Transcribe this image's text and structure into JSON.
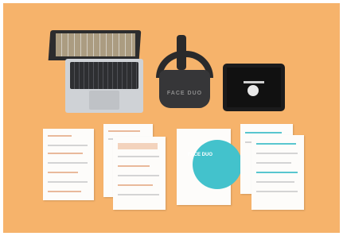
{
  "scene": {
    "colors": {
      "background": "#f6b36b",
      "paper": "#fdfcfa",
      "accent_orange": "#e9b99b",
      "accent_teal": "#43c2cc",
      "device_dark": "#2a2a2b"
    },
    "headset": {
      "logo_text": "FACE DUO"
    },
    "cover": {
      "title": "FACE DUO"
    }
  }
}
